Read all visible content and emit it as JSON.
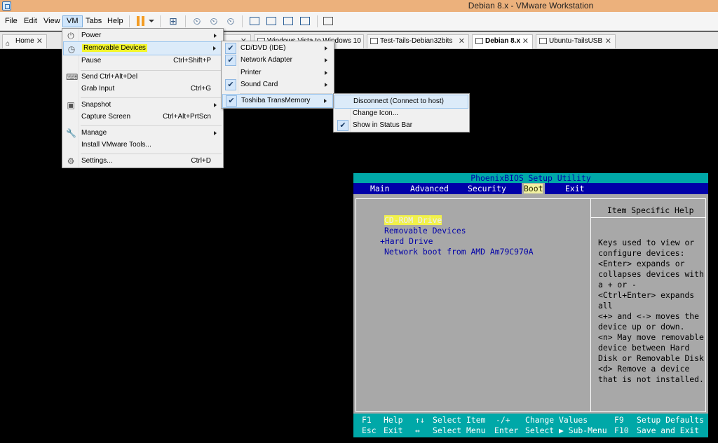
{
  "window": {
    "title": "Debian 8.x - VMware Workstation"
  },
  "menubar": {
    "items": [
      "File",
      "Edit",
      "View",
      "VM",
      "Tabs",
      "Help"
    ],
    "active": "VM"
  },
  "tabs": [
    {
      "label": "Home"
    },
    {
      "label": ""
    },
    {
      "label": "Windows Vista to Windows 10 ..."
    },
    {
      "label": "Test-Tails-Debian32bits"
    },
    {
      "label": "Debian 8.x"
    },
    {
      "label": "Ubuntu-TailsUSB"
    }
  ],
  "vm_menu": [
    {
      "label": "Power",
      "shortcut": "",
      "submenu": true
    },
    {
      "label": "Removable Devices",
      "shortcut": "",
      "submenu": true
    },
    {
      "label": "Pause",
      "shortcut": "Ctrl+Shift+P"
    },
    {
      "label": "Send Ctrl+Alt+Del",
      "shortcut": ""
    },
    {
      "label": "Grab Input",
      "shortcut": "Ctrl+G"
    },
    {
      "label": "Snapshot",
      "shortcut": "",
      "submenu": true
    },
    {
      "label": "Capture Screen",
      "shortcut": "Ctrl+Alt+PrtScn"
    },
    {
      "label": "Manage",
      "shortcut": "",
      "submenu": true
    },
    {
      "label": "Install VMware Tools...",
      "shortcut": ""
    },
    {
      "label": "Settings...",
      "shortcut": "Ctrl+D"
    }
  ],
  "removable_menu": [
    {
      "label": "CD/DVD (IDE)"
    },
    {
      "label": "Network Adapter"
    },
    {
      "label": "Printer"
    },
    {
      "label": "Sound Card"
    },
    {
      "label": "Toshiba TransMemory"
    }
  ],
  "device_menu": [
    {
      "label": "Disconnect (Connect to host)"
    },
    {
      "label": "Change Icon..."
    },
    {
      "label": "Show in Status Bar"
    }
  ],
  "check_mark": "✔",
  "bios": {
    "title": "PhoenixBIOS Setup Utility",
    "tabs": [
      "Main",
      "Advanced",
      "Security",
      "Boot",
      "Exit"
    ],
    "selected_tab": "Boot",
    "boot_items": [
      "CD-ROM Drive",
      "Removable Devices",
      "+Hard Drive",
      "Network boot from AMD Am79C970A"
    ],
    "help_title": "Item Specific Help",
    "help_text": "Keys used to view or\nconfigure devices:\n<Enter> expands or\ncollapses devices with\na + or -\n<Ctrl+Enter> expands\nall\n<+> and <-> moves the\ndevice up or down.\n<n> May move removable\ndevice between Hard\nDisk or Removable Disk\n<d> Remove a device\nthat is not installed.",
    "footer": {
      "row1": [
        {
          "key": "F1",
          "desc": "Help"
        },
        {
          "key": "↑↓",
          "desc": "Select Item"
        },
        {
          "key": "-/+",
          "desc": "Change Values"
        },
        {
          "key": "F9",
          "desc": "Setup Defaults"
        }
      ],
      "row2": [
        {
          "key": "Esc",
          "desc": "Exit"
        },
        {
          "key": "↔",
          "desc": "Select Menu"
        },
        {
          "key": "Enter",
          "desc": "Select ▶ Sub-Menu"
        },
        {
          "key": "F10",
          "desc": "Save and Exit"
        }
      ]
    }
  },
  "colors": {
    "titlebar": "#ecb17c",
    "bios_blue": "#0000a8",
    "bios_cyan": "#00a8a8",
    "bios_gray": "#a8a8a8",
    "highlight": "#f3f62c"
  }
}
